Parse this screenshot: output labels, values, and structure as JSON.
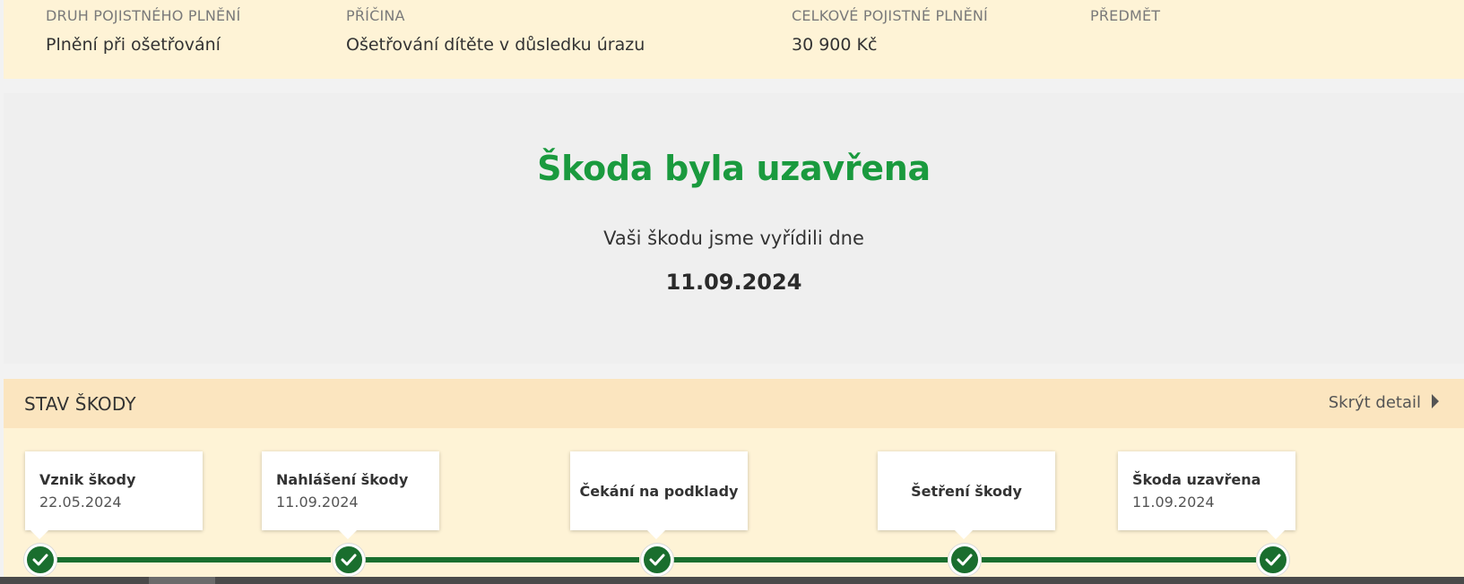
{
  "info": {
    "columns": [
      {
        "label": "DRUH POJISTNÉHO PLNĚNÍ",
        "value": "Plnění při ošetřování"
      },
      {
        "label": "PŘÍČINA",
        "value": "Ošetřování dítěte v důsledku úrazu"
      },
      {
        "label": "CELKOVÉ POJISTNÉ PLNĚNÍ",
        "value": "30 900 Kč"
      },
      {
        "label": "PŘEDMĚT",
        "value": ""
      }
    ]
  },
  "result": {
    "title": "Škoda byla uzavřena",
    "text": "Vaši škodu jsme vyřídili dne",
    "date": "11.09.2024"
  },
  "status": {
    "title": "STAV ŠKODY",
    "hide_detail": "Skrýt detail",
    "steps": [
      {
        "name": "Vznik škody",
        "date": "22.05.2024",
        "completed": true
      },
      {
        "name": "Nahlášení škody",
        "date": "11.09.2024",
        "completed": true
      },
      {
        "name": "Čekání na podklady",
        "date": "",
        "completed": true
      },
      {
        "name": "Šetření škody",
        "date": "",
        "completed": true
      },
      {
        "name": "Škoda uzavřena",
        "date": "11.09.2024",
        "completed": true
      }
    ]
  },
  "colors": {
    "accent_green": "#1a9a3e",
    "progress_green": "#1a6e2e",
    "panel_cream": "#fef3d6",
    "header_peach": "#fbe5bf"
  },
  "icons": {
    "step_completed": "check-icon",
    "hide_detail": "caret-right-icon"
  }
}
